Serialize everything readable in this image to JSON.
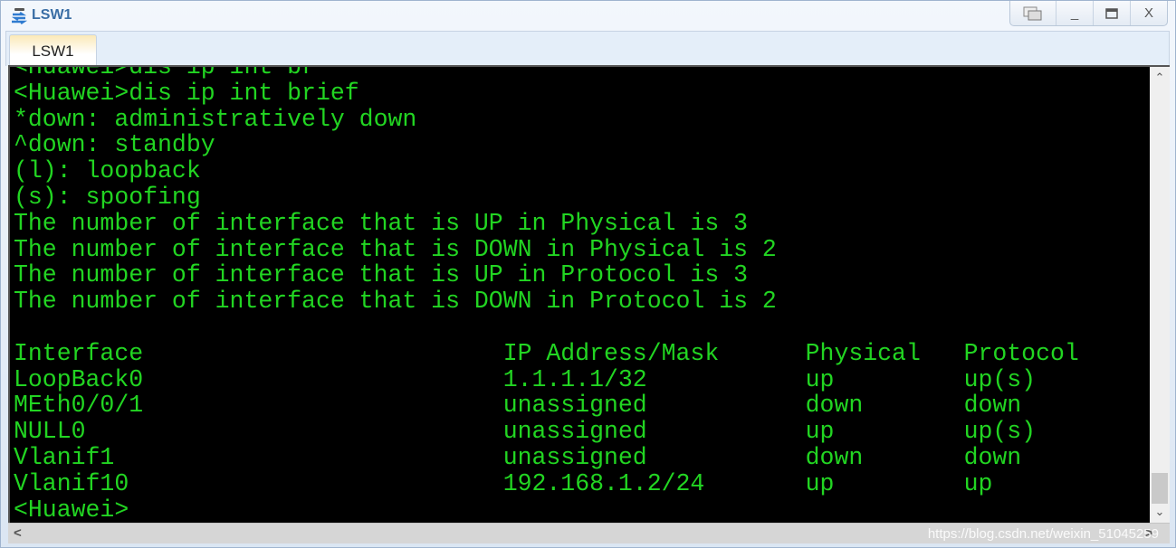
{
  "window": {
    "title": "LSW1",
    "controls": {
      "restore_icon": "restore-windows-icon",
      "minimize": "_",
      "maximize": "□",
      "close": "X"
    }
  },
  "tabs": [
    {
      "label": "LSW1",
      "active": true
    }
  ],
  "terminal": {
    "text_color": "#22d522",
    "background": "#000000",
    "lines": [
      "<Huawei>dis ip int br",
      "<Huawei>dis ip int brief",
      "*down: administratively down",
      "^down: standby",
      "(l): loopback",
      "(s): spoofing",
      "The number of interface that is UP in Physical is 3",
      "The number of interface that is DOWN in Physical is 2",
      "The number of interface that is UP in Protocol is 3",
      "The number of interface that is DOWN in Protocol is 2",
      "",
      "Interface                         IP Address/Mask      Physical   Protocol",
      "LoopBack0                         1.1.1.1/32           up         up(s)",
      "MEth0/0/1                         unassigned           down       down",
      "NULL0                             unassigned           up         up(s)",
      "Vlanif1                           unassigned           down       down",
      "Vlanif10                          192.168.1.2/24       up         up",
      "<Huawei>"
    ],
    "interface_table": {
      "columns": [
        "Interface",
        "IP Address/Mask",
        "Physical",
        "Protocol"
      ],
      "rows": [
        [
          "LoopBack0",
          "1.1.1.1/32",
          "up",
          "up(s)"
        ],
        [
          "MEth0/0/1",
          "unassigned",
          "down",
          "down"
        ],
        [
          "NULL0",
          "unassigned",
          "up",
          "up(s)"
        ],
        [
          "Vlanif1",
          "unassigned",
          "down",
          "down"
        ],
        [
          "Vlanif10",
          "192.168.1.2/24",
          "up",
          "up"
        ]
      ]
    }
  },
  "scrollbars": {
    "up_arrow": "^",
    "down_arrow": "v",
    "left_arrow": "<",
    "right_arrow": ">",
    "vertical_position": 0.97
  },
  "watermark": "https://blog.csdn.net/weixin_51045259"
}
